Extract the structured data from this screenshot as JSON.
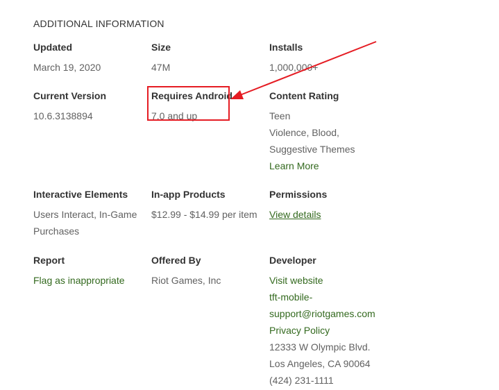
{
  "section": {
    "title": "ADDITIONAL INFORMATION"
  },
  "rows": [
    [
      {
        "label": "Updated",
        "lines": [
          "March 19, 2020"
        ]
      },
      {
        "label": "Size",
        "lines": [
          "47M"
        ]
      },
      {
        "label": "Installs",
        "lines": [
          "1,000,000+"
        ]
      }
    ],
    [
      {
        "label": "Current Version",
        "lines": [
          "10.6.3138894"
        ]
      },
      {
        "label": "Requires Android",
        "lines": [
          "7.0 and up"
        ]
      },
      {
        "label": "Content Rating",
        "lines": [
          "Teen",
          "Violence, Blood,",
          "Suggestive Themes"
        ],
        "link": "Learn More"
      }
    ],
    [
      {
        "label": "Interactive Elements",
        "lines": [
          "Users Interact, In-Game",
          "Purchases"
        ]
      },
      {
        "label": "In-app Products",
        "lines": [
          "$12.99 - $14.99 per item"
        ]
      },
      {
        "label": "Permissions",
        "link": "View details"
      }
    ],
    [
      {
        "label": "Report",
        "link": "Flag as inappropriate"
      },
      {
        "label": "Offered By",
        "lines": [
          "Riot Games, Inc"
        ]
      },
      {
        "label": "Developer",
        "links": [
          "Visit website",
          "tft-mobile-support@riotgames.com",
          "Privacy Policy"
        ],
        "lines": [
          "12333 W Olympic Blvd.",
          "Los Angeles, CA 90064",
          "(424) 231-1111"
        ]
      }
    ]
  ],
  "colors": {
    "link": "#33691e",
    "annotation": "#e51c23"
  }
}
